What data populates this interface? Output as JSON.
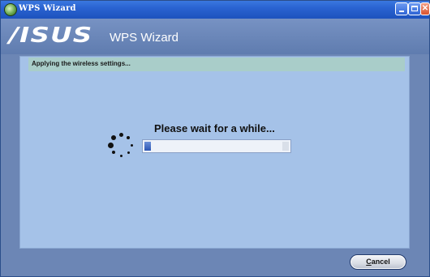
{
  "window": {
    "title": "WPS Wizard",
    "controls": {
      "minimize": "minimize",
      "maximize": "maximize",
      "close": "close"
    }
  },
  "header": {
    "logo": "/ISUS",
    "title": "WPS Wizard"
  },
  "status": {
    "message": "Applying the wireless settings..."
  },
  "main": {
    "wait_message": "Please wait for a while...",
    "progress": 0.03
  },
  "footer": {
    "cancel_label_first": "C",
    "cancel_label_rest": "ancel"
  },
  "icons": {
    "app": "wps-app-icon",
    "spinner": "loading-spinner-icon"
  },
  "colors": {
    "titlebar": "#2a63d1",
    "content_bg": "#a5c2e8",
    "status_bg": "#a9cdc9",
    "progress_fill": "#2c55b3"
  }
}
